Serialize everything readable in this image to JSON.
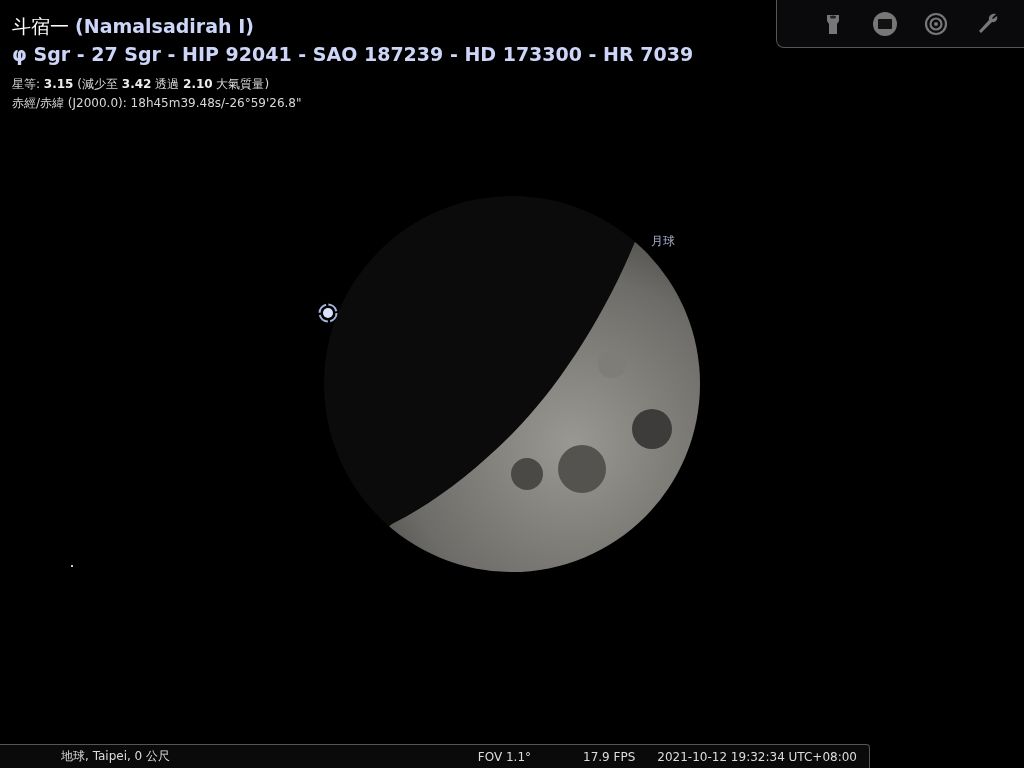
{
  "object_info": {
    "title": "斗宿一 **(Namalsadirah I)**",
    "designations": "φ Sgr - 27 Sgr - HIP 92041 - SAO 187239 - HD 173300 - HR 7039",
    "magnitude": "星等: **3.15** (減少至 **3.42** 透過 **2.10** 大氣質量)",
    "coordinates": "赤經/赤緯 (J2000.0): 18h45m39.48s/-26°59'26.8\""
  },
  "sky": {
    "moon_label": "月球"
  },
  "toolbar": [
    {
      "kind": "flashlight"
    },
    {
      "kind": "screen"
    },
    {
      "kind": "target"
    },
    {
      "kind": "wrench"
    }
  ],
  "status_bar": {
    "location": "地球, Taipei, 0 公尺",
    "fov": "FOV 1.1°",
    "fps": "17.9 FPS",
    "datetime": "2021-10-12 19:32:34 UTC+08:00"
  }
}
